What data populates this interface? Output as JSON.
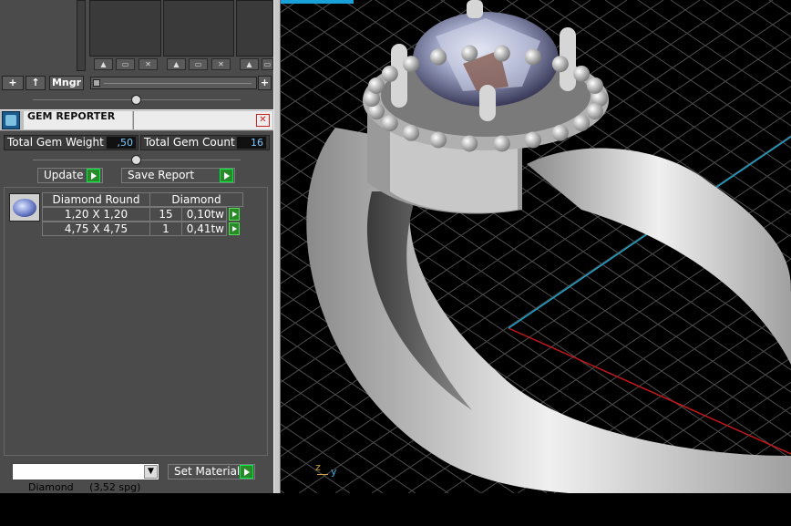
{
  "library": {
    "toolbar": {
      "add": "+",
      "up": "↑",
      "manager": "Mngr",
      "plus": "+"
    }
  },
  "gem_reporter": {
    "title": "GEM REPORTER",
    "total_weight_label": "Total Gem Weight",
    "total_weight_value": ",50",
    "total_count_label": "Total Gem Count",
    "total_count_value": "16",
    "update_label": "Update",
    "save_report_label": "Save Report",
    "table": {
      "headers": [
        "Diamond Round",
        "Diamond"
      ],
      "rows": [
        {
          "size": "1,20 X 1,20",
          "count": "15",
          "weight": "0,10tw"
        },
        {
          "size": "4,75 X 4,75",
          "count": "1",
          "weight": "0,41tw"
        }
      ]
    },
    "material_select": "Diamond     (3,52 spg)",
    "set_material_label": "Set Material"
  },
  "viewport": {
    "axis_z": "z",
    "axis_y": "y",
    "grid_color": "#4d4d4d",
    "axis_x_color": "#c01818",
    "axis_y_color": "#1ca0c8"
  }
}
